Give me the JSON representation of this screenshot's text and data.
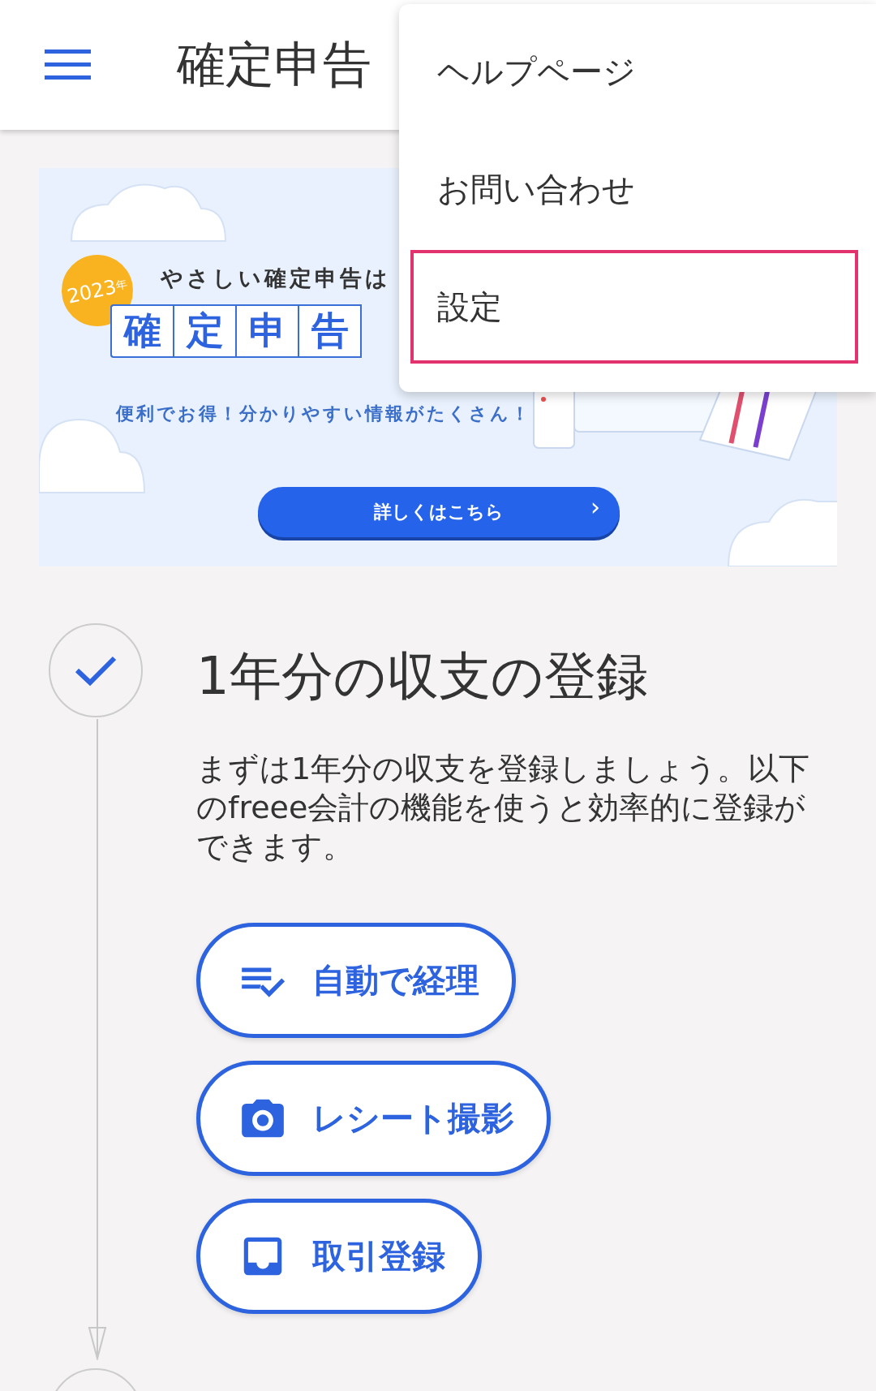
{
  "header": {
    "title": "確定申告"
  },
  "menu": {
    "items": [
      {
        "label": "ヘルプページ",
        "selected": false
      },
      {
        "label": "お問い合わせ",
        "selected": false
      },
      {
        "label": "設定",
        "selected": true
      }
    ]
  },
  "banner": {
    "badge_year": "2023",
    "badge_unit": "年",
    "tagline": "やさしい確定申告は",
    "headline": [
      "確",
      "定",
      "申",
      "告"
    ],
    "subtext": "便利でお得！分かりやすい情報がたくさん！",
    "button": "詳しくはこちら",
    "button_arrow": "›"
  },
  "step": {
    "done": true,
    "title": "1年分の収支の登録",
    "description": "まずは1年分の収支を登録しましょう。以下のfreee会計の機能を使うと効率的に登録ができます。",
    "actions": [
      {
        "kind": "auto",
        "label": "自動で経理"
      },
      {
        "kind": "camera",
        "label": "レシート撮影"
      },
      {
        "kind": "register",
        "label": "取引登録"
      }
    ]
  }
}
